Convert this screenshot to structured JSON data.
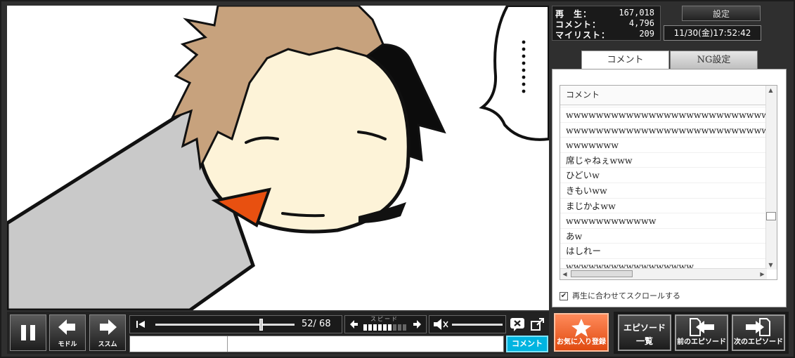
{
  "stats": {
    "plays_label": "再　生：",
    "plays_value": "167,018",
    "comments_label": "コメント：",
    "comments_value": "4,796",
    "mylist_label": "マイリスト：",
    "mylist_value": "209"
  },
  "header": {
    "settings_label": "設定",
    "datetime": "11/30(金)17:52:42"
  },
  "tabs": [
    {
      "label": "コメント"
    },
    {
      "label": "NG設定"
    }
  ],
  "comment_list": {
    "header": "コメント",
    "rows": [
      "wwwwwwwwwwwwwwwwwwwwwwwwwwwwwwww",
      "wwwwwwwwwwwwwwwwwwwwwwwwwwwwwwww",
      "wwwwwww",
      "席じゃねぇwww",
      "ひどいw",
      "きもいww",
      "まじかよww",
      "wwwwwwwwwwww",
      "あw",
      "はしれー",
      "wwwwwwwwwwwwwwwww"
    ]
  },
  "autoscroll_label": "再生に合わせてスクロールする",
  "controls": {
    "pause_icon": "pause-icon",
    "back_label": "モドル",
    "forward_label": "ススム",
    "time": "52/ 68",
    "speed_label": "スピード",
    "speed_level": 0.67
  },
  "comment_submit_label": "コメント",
  "favorite_label": "お気に入り登録",
  "episodes": {
    "list_line1": "エピソード",
    "list_line2": "一覧",
    "prev_label": "前のエピソード",
    "next_label": "次のエピソード"
  },
  "colors": {
    "accent_orange": "#e85a20",
    "submit_blue": "#00b4e0",
    "skin": "#fdf3d8",
    "hair": "#c7a27d",
    "mouth": "#e85010"
  }
}
